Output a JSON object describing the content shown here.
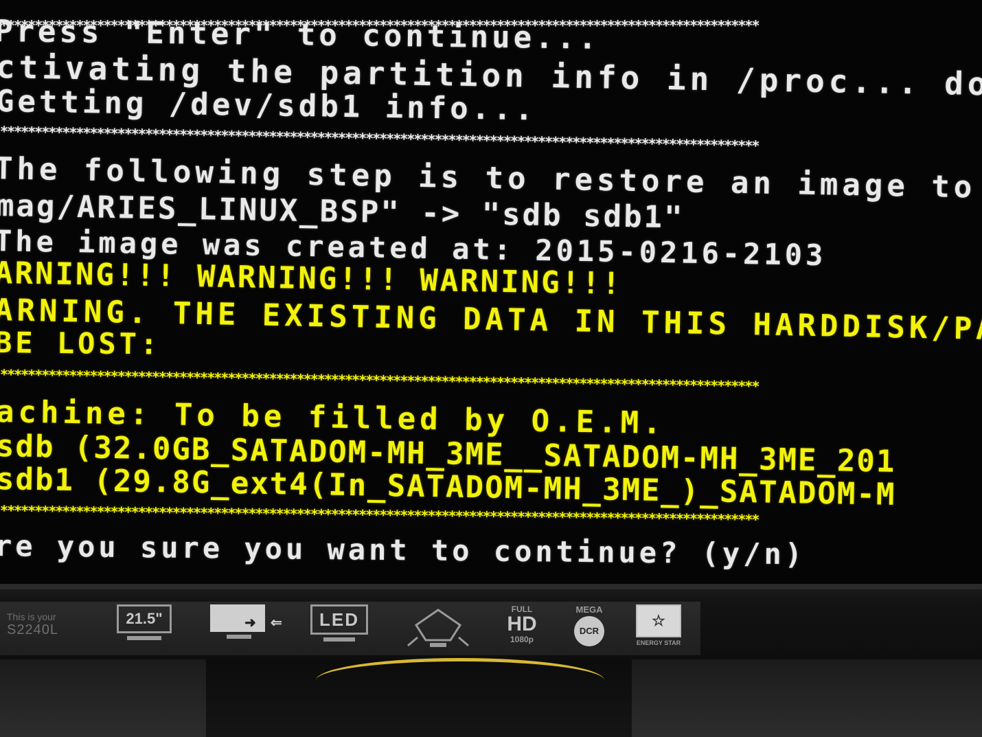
{
  "terminal": {
    "lines": [
      "Press \"Enter\" to continue...",
      "ctivating the partition info in /proc... don",
      "Getting /dev/sdb1 info...",
      "The following step is to restore an image to",
      "mag/ARIES_LINUX_BSP\" -> \"sdb sdb1\"",
      "The image was created at: 2015-0216-2103",
      "ARNING!!! WARNING!!! WARNING!!!",
      "ARNING. THE EXISTING DATA IN THIS HARDDISK/PA",
      "BE LOST:",
      "achine: To be filled by O.E.M.",
      "sdb (32.0GB_SATADOM-MH_3ME__SATADOM-MH_3ME_201",
      "sdb1 (29.8G_ext4(In_SATADOM-MH_3ME_)_SATADOM-M",
      "re you sure you want to continue? (y/n)"
    ],
    "separator": "**************************************************************************************************************"
  },
  "bezel": {
    "model_small": "This is your",
    "model_big": "S2240L",
    "badges": {
      "size": "21.5\"",
      "led": "LED",
      "full": "FULL",
      "hd": "HD",
      "hd_sub": "1080p",
      "mega": "MEGA",
      "dcr": "DCR",
      "energy": "ENERGY STAR"
    }
  },
  "colors": {
    "white_text": "#e9e9e9",
    "yellow_text": "#f2f20a",
    "screen_bg": "#050505"
  }
}
